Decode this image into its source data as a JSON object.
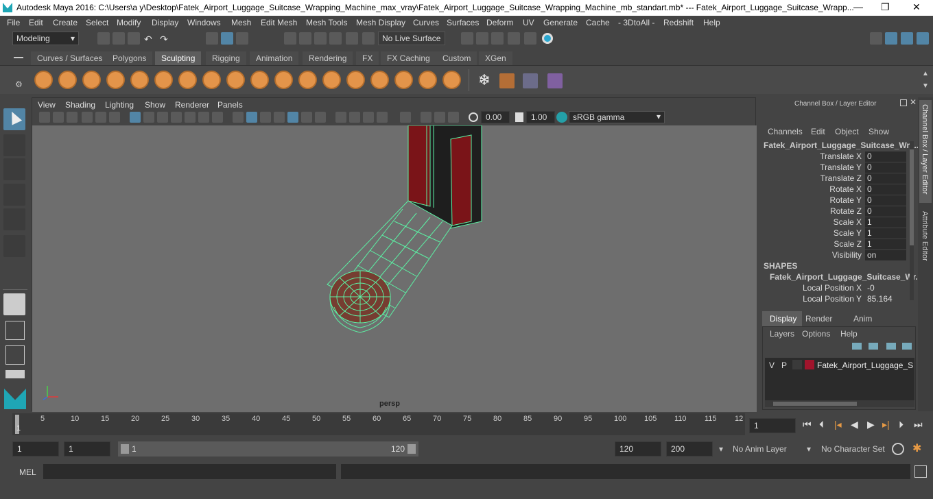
{
  "window": {
    "title": "Autodesk Maya 2016: C:\\Users\\a y\\Desktop\\Fatek_Airport_Luggage_Suitcase_Wrapping_Machine_max_vray\\Fatek_Airport_Luggage_Suitcase_Wrapping_Machine_mb_standart.mb*   ---   Fatek_Airport_Luggage_Suitcase_Wrapp...",
    "min": "—",
    "max": "❐",
    "close": "✕"
  },
  "menus": [
    "File",
    "Edit",
    "Create",
    "Select",
    "Modify",
    "Display",
    "Windows",
    "Mesh",
    "Edit Mesh",
    "Mesh Tools",
    "Mesh Display",
    "Curves",
    "Surfaces",
    "Deform",
    "UV",
    "Generate",
    "Cache",
    "- 3DtoAll -",
    "Redshift",
    "Help"
  ],
  "status": {
    "mode": "Modeling",
    "live_surface": "No Live Surface"
  },
  "shelf_tabs": [
    "Curves / Surfaces",
    "Polygons",
    "Sculpting",
    "Rigging",
    "Animation",
    "Rendering",
    "FX",
    "FX Caching",
    "Custom",
    "XGen"
  ],
  "shelf_active": "Sculpting",
  "viewport": {
    "menus": [
      "View",
      "Shading",
      "Lighting",
      "Show",
      "Renderer",
      "Panels"
    ],
    "exposure": "0.00",
    "gamma": "1.00",
    "colorspace": "sRGB gamma",
    "camera_label": "persp"
  },
  "channel_box": {
    "header": "Channel Box / Layer Editor",
    "menus": [
      "Channels",
      "Edit",
      "Object",
      "Show"
    ],
    "object_name": "Fatek_Airport_Luggage_Suitcase_Wra...",
    "attributes": [
      {
        "name": "Translate X",
        "value": "0"
      },
      {
        "name": "Translate Y",
        "value": "0"
      },
      {
        "name": "Translate Z",
        "value": "0"
      },
      {
        "name": "Rotate X",
        "value": "0"
      },
      {
        "name": "Rotate Y",
        "value": "0"
      },
      {
        "name": "Rotate Z",
        "value": "0"
      },
      {
        "name": "Scale X",
        "value": "1"
      },
      {
        "name": "Scale Y",
        "value": "1"
      },
      {
        "name": "Scale Z",
        "value": "1"
      },
      {
        "name": "Visibility",
        "value": "on"
      }
    ],
    "shapes_label": "SHAPES",
    "shape_name": "Fatek_Airport_Luggage_Suitcase_Wr...",
    "shape_attrs": [
      {
        "name": "Local Position X",
        "value": "-0"
      },
      {
        "name": "Local Position Y",
        "value": "85.164"
      }
    ]
  },
  "layer_editor": {
    "tabs": [
      "Display",
      "Render",
      "Anim"
    ],
    "active_tab": "Display",
    "menus": [
      "Layers",
      "Options",
      "Help"
    ],
    "layer": {
      "v": "V",
      "p": "P",
      "name": "Fatek_Airport_Luggage_Suit",
      "color": "#a0142c"
    }
  },
  "side_tabs": [
    "Channel Box / Layer Editor",
    "Attribute Editor"
  ],
  "timeline": {
    "ticks": [
      "5",
      "10",
      "15",
      "20",
      "25",
      "30",
      "35",
      "40",
      "45",
      "50",
      "55",
      "60",
      "65",
      "70",
      "75",
      "80",
      "85",
      "90",
      "95",
      "100",
      "105",
      "110",
      "115",
      "12"
    ],
    "current": "1",
    "frame_field": "1"
  },
  "range": {
    "start": "1",
    "start2": "1",
    "slider_start": "1",
    "slider_end": "120",
    "end": "120",
    "end2": "200",
    "anim_layer": "No Anim Layer",
    "char_set": "No Character Set"
  },
  "mel": {
    "label": "MEL"
  },
  "colors": {
    "wire": "#5cf3a5",
    "accent": "#5d5d5d"
  }
}
